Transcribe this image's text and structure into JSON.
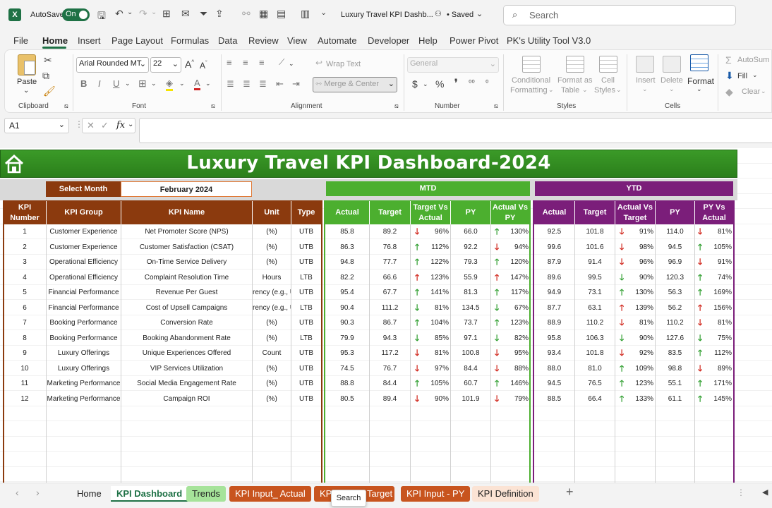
{
  "titlebar": {
    "autosave_label": "AutoSave",
    "autosave_state": "On",
    "file_title": "Luxury Travel KPI Dashb...",
    "saved_label": "• Saved",
    "search_placeholder": "Search"
  },
  "menu": [
    "File",
    "Home",
    "Insert",
    "Page Layout",
    "Formulas",
    "Data",
    "Review",
    "View",
    "Automate",
    "Developer",
    "Help",
    "Power Pivot",
    "PK's Utility Tool V3.0"
  ],
  "ribbon": {
    "paste": "Paste",
    "clipboard": "Clipboard",
    "font_name": "Arial Rounded MT",
    "font_size": "22",
    "font": "Font",
    "wrap_text": "Wrap Text",
    "merge_center": "Merge & Center",
    "alignment": "Alignment",
    "number_format": "General",
    "number": "Number",
    "cond_fmt_1": "Conditional",
    "cond_fmt_2": "Formatting",
    "format_table_1": "Format as",
    "format_table_2": "Table",
    "cell_styles_1": "Cell",
    "cell_styles_2": "Styles",
    "styles": "Styles",
    "insert": "Insert",
    "delete": "Delete",
    "format": "Format",
    "cells": "Cells",
    "autosum": "AutoSum",
    "fill": "Fill",
    "clear": "Clear"
  },
  "formula": {
    "name_box": "A1",
    "fx": "fx"
  },
  "dashboard": {
    "title": "Luxury Travel KPI Dashboard-2024",
    "select_month_label": "Select Month",
    "selected_month": "February 2024",
    "mtd_label": "MTD",
    "ytd_label": "YTD",
    "left_headers": [
      "KPI Number",
      "KPI Group",
      "KPI Name",
      "Unit",
      "Type"
    ],
    "mtd_headers": [
      "Actual",
      "Target",
      "Target Vs Actual",
      "PY",
      "Actual Vs PY"
    ],
    "ytd_headers": [
      "Actual",
      "Target",
      "Actual Vs Target",
      "PY",
      "PY Vs Actual"
    ],
    "colors": {
      "title_green": "#2e8b1f",
      "brown": "#8b3a0e",
      "mtd_green": "#4caf2f",
      "ytd_purple": "#7b1e7a",
      "up": "#2e9e2e",
      "down": "#d0241a"
    },
    "rows": [
      {
        "n": "1",
        "group": "Customer Experience",
        "name": "Net Promoter Score (NPS)",
        "unit": "(%)",
        "type": "UTB",
        "m_act": "85.8",
        "m_tgt": "89.2",
        "m_tva_dir": "down",
        "m_tva": "96%",
        "m_py": "66.0",
        "m_avp_dir": "up",
        "m_avp": "130%",
        "y_act": "92.5",
        "y_tgt": "101.8",
        "y_avt_dir": "down",
        "y_avt": "91%",
        "y_py": "114.0",
        "y_pva_dir": "down",
        "y_pva": "81%"
      },
      {
        "n": "2",
        "group": "Customer Experience",
        "name": "Customer Satisfaction (CSAT)",
        "unit": "(%)",
        "type": "UTB",
        "m_act": "86.3",
        "m_tgt": "76.8",
        "m_tva_dir": "up",
        "m_tva": "112%",
        "m_py": "92.2",
        "m_avp_dir": "down",
        "m_avp": "94%",
        "y_act": "99.6",
        "y_tgt": "101.6",
        "y_avt_dir": "down",
        "y_avt": "98%",
        "y_py": "94.5",
        "y_pva_dir": "up",
        "y_pva": "105%"
      },
      {
        "n": "3",
        "group": "Operational Efficiency",
        "name": "On-Time Service Delivery",
        "unit": "(%)",
        "type": "UTB",
        "m_act": "94.8",
        "m_tgt": "77.7",
        "m_tva_dir": "up",
        "m_tva": "122%",
        "m_py": "79.3",
        "m_avp_dir": "up",
        "m_avp": "120%",
        "y_act": "87.9",
        "y_tgt": "91.4",
        "y_avt_dir": "down",
        "y_avt": "96%",
        "y_py": "96.9",
        "y_pva_dir": "down",
        "y_pva": "91%"
      },
      {
        "n": "4",
        "group": "Operational Efficiency",
        "name": "Complaint Resolution Time",
        "unit": "Hours",
        "type": "LTB",
        "m_act": "82.2",
        "m_tgt": "66.6",
        "m_tva_dir": "up_red",
        "m_tva": "123%",
        "m_py": "55.9",
        "m_avp_dir": "up_red",
        "m_avp": "147%",
        "y_act": "89.6",
        "y_tgt": "99.5",
        "y_avt_dir": "down_green",
        "y_avt": "90%",
        "y_py": "120.3",
        "y_pva_dir": "up",
        "y_pva": "74%"
      },
      {
        "n": "5",
        "group": "Financial Performance",
        "name": "Revenue Per Guest",
        "unit": "rency (e.g., U",
        "type": "UTB",
        "m_act": "95.4",
        "m_tgt": "67.7",
        "m_tva_dir": "up",
        "m_tva": "141%",
        "m_py": "81.3",
        "m_avp_dir": "up",
        "m_avp": "117%",
        "y_act": "94.9",
        "y_tgt": "73.1",
        "y_avt_dir": "up",
        "y_avt": "130%",
        "y_py": "56.3",
        "y_pva_dir": "up",
        "y_pva": "169%"
      },
      {
        "n": "6",
        "group": "Financial Performance",
        "name": "Cost of Upsell Campaigns",
        "unit": "rency (e.g., U",
        "type": "LTB",
        "m_act": "90.4",
        "m_tgt": "111.2",
        "m_tva_dir": "down_green",
        "m_tva": "81%",
        "m_py": "134.5",
        "m_avp_dir": "down_green",
        "m_avp": "67%",
        "y_act": "87.7",
        "y_tgt": "63.1",
        "y_avt_dir": "up_red",
        "y_avt": "139%",
        "y_py": "56.2",
        "y_pva_dir": "up_red",
        "y_pva": "156%"
      },
      {
        "n": "7",
        "group": "Booking Performance",
        "name": "Conversion Rate",
        "unit": "(%)",
        "type": "UTB",
        "m_act": "90.3",
        "m_tgt": "86.7",
        "m_tva_dir": "up",
        "m_tva": "104%",
        "m_py": "73.7",
        "m_avp_dir": "up",
        "m_avp": "123%",
        "y_act": "88.9",
        "y_tgt": "110.2",
        "y_avt_dir": "down",
        "y_avt": "81%",
        "y_py": "110.2",
        "y_pva_dir": "down",
        "y_pva": "81%"
      },
      {
        "n": "8",
        "group": "Booking Performance",
        "name": "Booking Abandonment Rate",
        "unit": "(%)",
        "type": "LTB",
        "m_act": "79.9",
        "m_tgt": "94.3",
        "m_tva_dir": "down_green",
        "m_tva": "85%",
        "m_py": "97.1",
        "m_avp_dir": "down_green",
        "m_avp": "82%",
        "y_act": "95.8",
        "y_tgt": "106.3",
        "y_avt_dir": "down_green",
        "y_avt": "90%",
        "y_py": "127.6",
        "y_pva_dir": "down_green",
        "y_pva": "75%"
      },
      {
        "n": "9",
        "group": "Luxury Offerings",
        "name": "Unique Experiences Offered",
        "unit": "Count",
        "type": "UTB",
        "m_act": "95.3",
        "m_tgt": "117.2",
        "m_tva_dir": "down",
        "m_tva": "81%",
        "m_py": "100.8",
        "m_avp_dir": "down",
        "m_avp": "95%",
        "y_act": "93.4",
        "y_tgt": "101.8",
        "y_avt_dir": "down",
        "y_avt": "92%",
        "y_py": "83.5",
        "y_pva_dir": "up",
        "y_pva": "112%"
      },
      {
        "n": "10",
        "group": "Luxury Offerings",
        "name": "VIP Services Utilization",
        "unit": "(%)",
        "type": "UTB",
        "m_act": "74.5",
        "m_tgt": "76.7",
        "m_tva_dir": "down",
        "m_tva": "97%",
        "m_py": "84.4",
        "m_avp_dir": "down",
        "m_avp": "88%",
        "y_act": "88.0",
        "y_tgt": "81.0",
        "y_avt_dir": "up",
        "y_avt": "109%",
        "y_py": "98.8",
        "y_pva_dir": "down",
        "y_pva": "89%"
      },
      {
        "n": "11",
        "group": "Marketing Performance",
        "name": "Social Media Engagement Rate",
        "unit": "(%)",
        "type": "UTB",
        "m_act": "88.8",
        "m_tgt": "84.4",
        "m_tva_dir": "up",
        "m_tva": "105%",
        "m_py": "60.7",
        "m_avp_dir": "up",
        "m_avp": "146%",
        "y_act": "94.5",
        "y_tgt": "76.5",
        "y_avt_dir": "up",
        "y_avt": "123%",
        "y_py": "55.1",
        "y_pva_dir": "up",
        "y_pva": "171%"
      },
      {
        "n": "12",
        "group": "Marketing Performance",
        "name": "Campaign ROI",
        "unit": "(%)",
        "type": "UTB",
        "m_act": "80.5",
        "m_tgt": "89.4",
        "m_tva_dir": "down",
        "m_tva": "90%",
        "m_py": "101.9",
        "m_avp_dir": "down",
        "m_avp": "79%",
        "y_act": "88.5",
        "y_tgt": "66.4",
        "y_avt_dir": "up",
        "y_avt": "133%",
        "y_py": "61.1",
        "y_pva_dir": "up",
        "y_pva": "145%"
      }
    ]
  },
  "tabs": [
    "Home",
    "KPI Dashboard",
    "Trends",
    "KPI Input_ Actual",
    "KPI",
    "Target",
    "KPI Input - PY",
    "KPI Definition"
  ],
  "tooltip": "Search"
}
